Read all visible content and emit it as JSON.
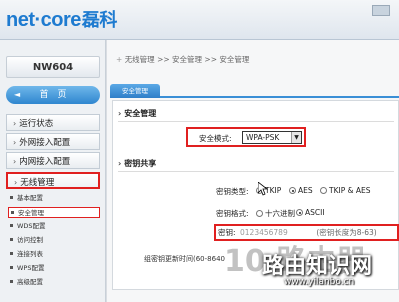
{
  "header": {
    "logo_text": "net·core",
    "logo_cn": "磊科"
  },
  "sidebar": {
    "model": "NW604",
    "home_label": "首　页",
    "items": [
      {
        "label": "运行状态"
      },
      {
        "label": "外网接入配置"
      },
      {
        "label": "内网接入配置"
      },
      {
        "label": "无线管理"
      }
    ],
    "subitems": [
      {
        "label": "基本配置"
      },
      {
        "label": "安全管理"
      },
      {
        "label": "WDS配置"
      },
      {
        "label": "访问控制"
      },
      {
        "label": "连接列表"
      },
      {
        "label": "WPS配置"
      },
      {
        "label": "高级配置"
      }
    ]
  },
  "breadcrumb": "无线管理 >> 安全管理 >> 安全管理",
  "tab": "安全管理",
  "security": {
    "section_title": "安全管理",
    "mode_label": "安全模式:",
    "mode_value": "WPA-PSK"
  },
  "key_share": {
    "section_title": "密钥共享",
    "type_label": "密钥类型:",
    "type_options": [
      "TKIP",
      "AES",
      "TKIP & AES"
    ],
    "type_selected": "AES",
    "format_label": "密钥格式:",
    "format_options": [
      "十六进制",
      "ASCII"
    ],
    "format_selected": "ASCII",
    "key_label": "密钥:",
    "key_value": "0123456789",
    "key_hint": "(密钥长度为8-63)",
    "update_text": "组密钥更新时间(60-8640"
  },
  "watermark": {
    "bg_text": "10 路由器",
    "text": "路由知识网",
    "url": "www.yilanbo.cn"
  },
  "colors": {
    "accent_blue": "#2f86cf",
    "highlight_red": "#e02020"
  }
}
